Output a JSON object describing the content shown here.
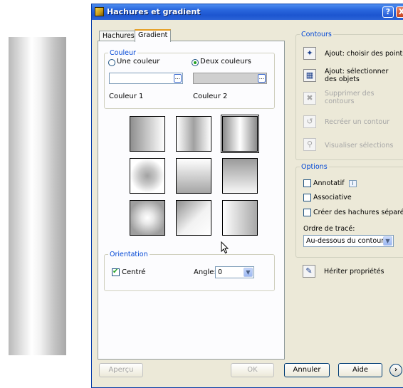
{
  "window": {
    "title": "Hachures et gradient",
    "help": "?",
    "close": "X"
  },
  "tabs": [
    {
      "label": "Hachures"
    },
    {
      "label": "Gradient"
    }
  ],
  "couleur": {
    "legend": "Couleur",
    "one_color": "Une couleur",
    "two_colors": "Deux couleurs",
    "selected": "Deux couleurs",
    "color1_label": "Couleur 1",
    "color2_label": "Couleur 2",
    "browse": "..."
  },
  "patterns": [
    "linear-horizontal",
    "cylinder-horizontal",
    "inverted-cylinder",
    "spherical",
    "hemispherical",
    "curved",
    "inverted-spherical",
    "inverted-hemispherical",
    "inverted-curved"
  ],
  "selected_pattern": "inverted-cylinder",
  "orientation": {
    "legend": "Orientation",
    "centered_label": "Centré",
    "centered_checked": true,
    "angle_label": "Angle:",
    "angle_value": "0"
  },
  "contours": {
    "legend": "Contours",
    "items": [
      {
        "label": "Ajout: choisir des points",
        "enabled": true
      },
      {
        "label": "Ajout: sélectionner des objets",
        "enabled": true
      },
      {
        "label": "Supprimer des contours",
        "enabled": false
      },
      {
        "label": "Recréer un contour",
        "enabled": false
      },
      {
        "label": "Visualiser sélections",
        "enabled": false
      }
    ]
  },
  "options": {
    "legend": "Options",
    "annotative": "Annotatif",
    "associative": "Associative",
    "separate": "Créer des hachures séparées",
    "draw_order_label": "Ordre de tracé:",
    "draw_order_value": "Au-dessous du contour",
    "inherit": "Hériter propriétés"
  },
  "buttons": {
    "preview": "Aperçu",
    "ok": "OK",
    "cancel": "Annuler",
    "help": "Aide",
    "more": "›"
  },
  "colors": {
    "title_bar": "#2a67dd",
    "legend_text": "#0046d5",
    "dialog_bg": "#ece9d8"
  }
}
